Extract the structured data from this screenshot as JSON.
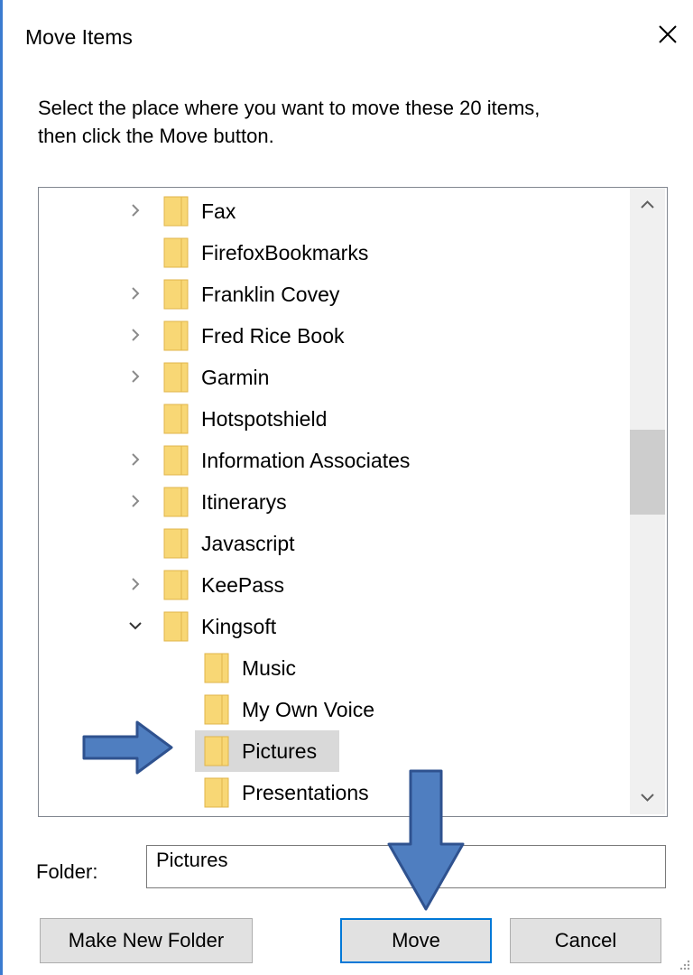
{
  "dialog": {
    "title": "Move Items",
    "instruction_line1": "Select the place where you want to move these 20 items,",
    "instruction_line2": "then click the Move button."
  },
  "tree": {
    "items": [
      {
        "label": "Fax",
        "expander": "collapsed",
        "level": 0
      },
      {
        "label": "FirefoxBookmarks",
        "expander": "none",
        "level": 0
      },
      {
        "label": "Franklin Covey",
        "expander": "collapsed",
        "level": 0
      },
      {
        "label": "Fred Rice Book",
        "expander": "collapsed",
        "level": 0
      },
      {
        "label": "Garmin",
        "expander": "collapsed",
        "level": 0
      },
      {
        "label": "Hotspotshield",
        "expander": "none",
        "level": 0
      },
      {
        "label": "Information Associates",
        "expander": "collapsed",
        "level": 0
      },
      {
        "label": "Itinerarys",
        "expander": "collapsed",
        "level": 0
      },
      {
        "label": "Javascript",
        "expander": "none",
        "level": 0
      },
      {
        "label": "KeePass",
        "expander": "collapsed",
        "level": 0
      },
      {
        "label": "Kingsoft",
        "expander": "expanded",
        "level": 0
      },
      {
        "label": "Music",
        "expander": "none",
        "level": 1
      },
      {
        "label": "My Own Voice",
        "expander": "none",
        "level": 1
      },
      {
        "label": "Pictures",
        "expander": "none",
        "level": 1,
        "selected": true
      },
      {
        "label": "Presentations",
        "expander": "none",
        "level": 1
      }
    ]
  },
  "folder": {
    "label": "Folder:",
    "value": "Pictures"
  },
  "buttons": {
    "make_new_folder": "Make New Folder",
    "move": "Move",
    "cancel": "Cancel"
  },
  "colors": {
    "folder_fill": "#f8d775",
    "folder_edge": "#e0b54b",
    "selection": "#d9d9d9",
    "primary_border": "#0078d7",
    "annotation_arrow_fill": "#4f7ec0",
    "annotation_arrow_stroke": "#2f528f"
  },
  "icons": {
    "close": "close-icon",
    "expand_collapsed": "chevron-right-icon",
    "expand_expanded": "chevron-down-icon",
    "folder": "folder-icon",
    "scroll_up": "scroll-up-icon",
    "scroll_down": "scroll-down-icon"
  }
}
